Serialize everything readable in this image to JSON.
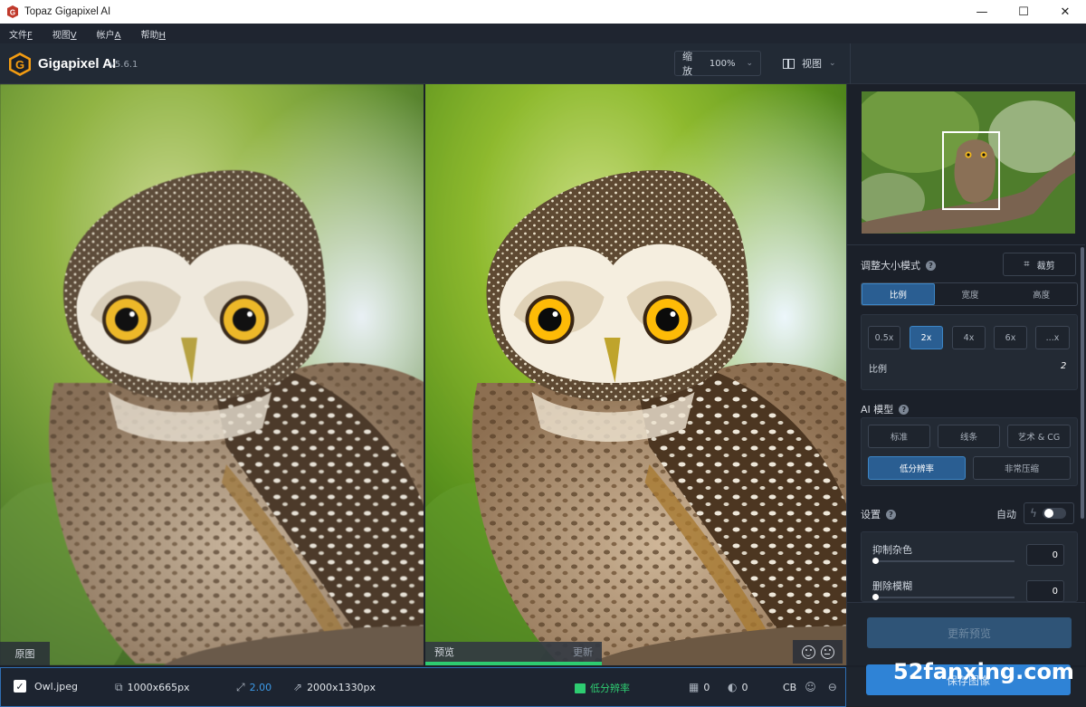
{
  "window": {
    "title": "Topaz Gigapixel AI",
    "minimize": "—",
    "maximize": "☐",
    "close": "✕"
  },
  "menu": [
    {
      "label": "文件",
      "key": "F"
    },
    {
      "label": "视图",
      "key": "V"
    },
    {
      "label": "帐户",
      "key": "A"
    },
    {
      "label": "帮助",
      "key": "H"
    }
  ],
  "header": {
    "app_name": "Gigapixel AI",
    "version": "v5.6.1",
    "zoom_label": "缩放",
    "zoom_value": "100%",
    "view_label": "视图"
  },
  "panes": {
    "original_label": "原图",
    "preview_label": "预览",
    "update_label": "更新",
    "preview_progress": 1.0
  },
  "sidebar": {
    "resize_title": "调整大小模式",
    "crop_label": "裁剪",
    "resize_tabs": [
      "比例",
      "宽度",
      "高度"
    ],
    "resize_active": 0,
    "scale_options": [
      "0.5x",
      "2x",
      "4x",
      "6x",
      "...x"
    ],
    "scale_active": 1,
    "scale_label": "比例",
    "scale_value": "2",
    "ai_title": "AI 模型",
    "ai_models_row1": [
      "标准",
      "线条",
      "艺术 & CG"
    ],
    "ai_models_row2": [
      "低分辨率",
      "非常压缩"
    ],
    "ai_active": "低分辨率",
    "settings_title": "设置",
    "auto_label": "自动",
    "suppress_noise_label": "抑制杂色",
    "suppress_noise_value": "0",
    "remove_blur_label": "删除模糊",
    "remove_blur_value": "0",
    "update_preview_button": "更新预览",
    "save_button": "保存图像"
  },
  "status": {
    "filename": "Owl.jpeg",
    "input_size": "1000x665px",
    "scale": "2.00",
    "output_size": "2000x1330px",
    "model": "低分辨率",
    "count_a": "0",
    "count_b": "0",
    "cb": "CB"
  },
  "watermark": "52fanxing.com",
  "colors": {
    "accent": "#2f83d6",
    "active_tab": "#2a5e92",
    "lowres": "#2ecc71",
    "logo_orange": "#f39c12"
  }
}
